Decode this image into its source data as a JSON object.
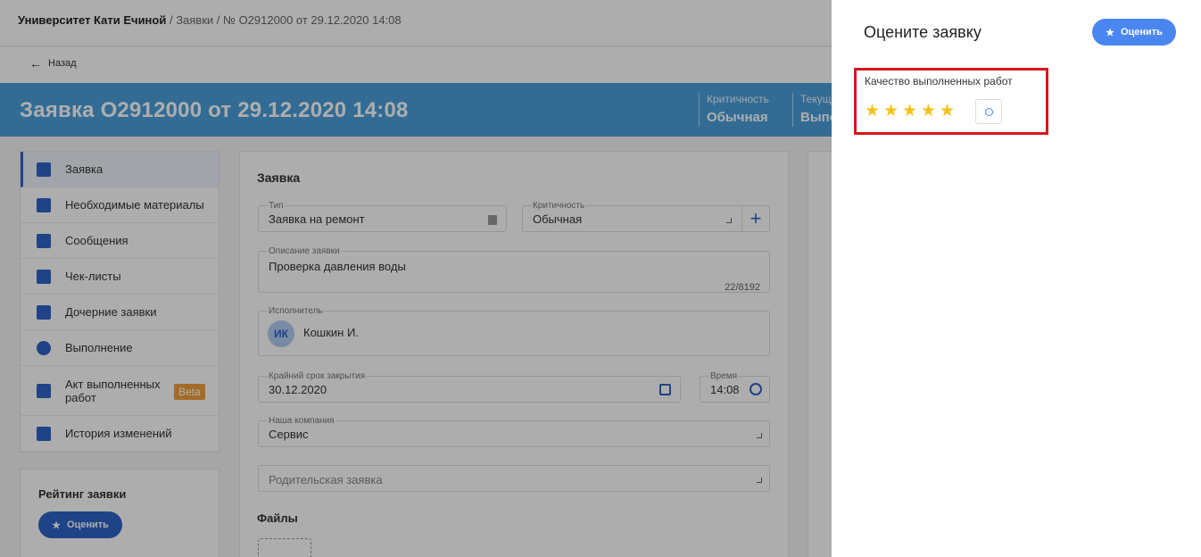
{
  "breadcrumb": {
    "org": "Университет Кати Ечиной",
    "sep1": " / ",
    "section": "Заявки",
    "sep2": " / ",
    "item": "№ O2912000 от 29.12.2020 14:08"
  },
  "back": {
    "label": "Назад"
  },
  "hero": {
    "title": "Заявка O2912000 от 29.12.2020 14:08",
    "criticality_label": "Критичность",
    "criticality_value": "Обычная",
    "current_label": "Текущ",
    "current_value": "Выпо"
  },
  "sidebar": {
    "items": [
      {
        "label": "Заявка"
      },
      {
        "label": "Необходимые материалы"
      },
      {
        "label": "Сообщения"
      },
      {
        "label": "Чек-листы"
      },
      {
        "label": "Дочерние заявки"
      },
      {
        "label": "Выполнение"
      },
      {
        "label": "Акт выполненных работ",
        "badge": "Beta"
      },
      {
        "label": "История изменений"
      }
    ]
  },
  "rating_card": {
    "title": "Рейтинг заявки",
    "button": "Оценить"
  },
  "form": {
    "heading": "Заявка",
    "type": {
      "label": "Тип",
      "value": "Заявка на ремонт"
    },
    "criticality": {
      "label": "Критичность",
      "value": "Обычная",
      "add": "+"
    },
    "description": {
      "label": "Описание заявки",
      "value": "Проверка давления воды",
      "counter": "22/8192"
    },
    "executor": {
      "label": "Исполнитель",
      "initials": "ИК",
      "name": "Кошкин И."
    },
    "deadline": {
      "label": "Крайний срок закрытия",
      "value": "30.12.2020"
    },
    "time": {
      "label": "Время",
      "value": "14:08"
    },
    "company": {
      "label": "Наша компания",
      "value": "Сервис"
    },
    "parent": {
      "placeholder": "Родительская заявка"
    },
    "files": "Файлы"
  },
  "panel": {
    "title": "Оцените заявку",
    "button": "Оценить",
    "quality_label": "Качество выполненных работ",
    "stars": 5,
    "max_stars": 5
  },
  "colors": {
    "accent": "#4a86f0",
    "hero": "#4a9fdc",
    "star": "#f6c21b",
    "highlight": "#d6161c",
    "beta": "#f0a13a"
  }
}
